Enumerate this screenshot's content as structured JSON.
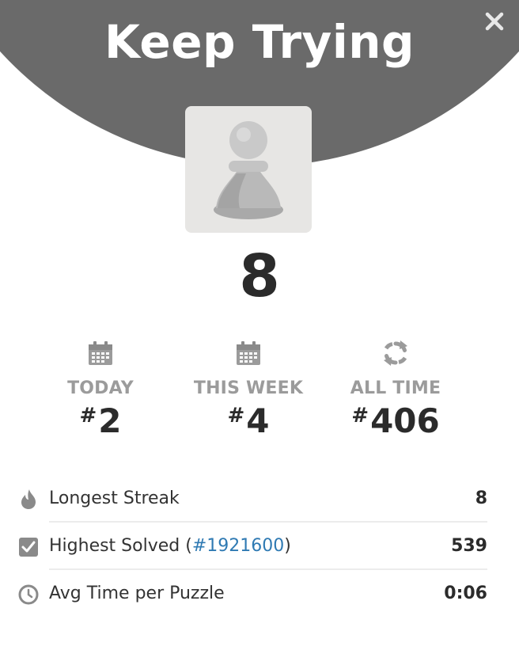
{
  "header": {
    "title": "Keep Trying",
    "background_color": "#6a6a6a"
  },
  "close_button": {
    "icon": "close-icon"
  },
  "result": {
    "piece_icon": "pawn-icon",
    "score": "8"
  },
  "rankings": [
    {
      "icon": "calendar-icon",
      "label": "TODAY",
      "hash": "#",
      "value": "2"
    },
    {
      "icon": "calendar-icon",
      "label": "THIS WEEK",
      "hash": "#",
      "value": "4"
    },
    {
      "icon": "refresh-icon",
      "label": "ALL TIME",
      "hash": "#",
      "value": "406"
    }
  ],
  "stats": {
    "longest_streak": {
      "icon": "flame-icon",
      "label": "Longest Streak",
      "value": "8"
    },
    "highest_solved": {
      "icon": "checkbox-icon",
      "label_prefix": "Highest Solved (",
      "link_text": "#1921600",
      "label_suffix": ")",
      "value": "539"
    },
    "avg_time": {
      "icon": "clock-icon",
      "label": "Avg Time per Puzzle",
      "value": "0:06"
    }
  },
  "colors": {
    "link": "#2f7ab3",
    "muted": "#9b9b9b",
    "text": "#2b2b2b"
  }
}
